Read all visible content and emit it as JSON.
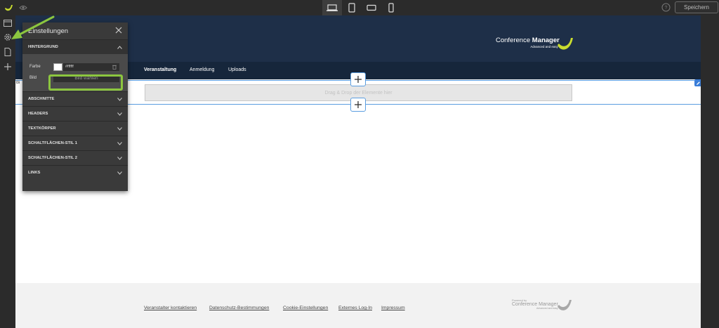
{
  "toolbar": {
    "save_label": "Speichern",
    "devices": [
      "desktop",
      "tablet-portrait",
      "tablet-landscape",
      "phone"
    ]
  },
  "sidebar": {
    "items": [
      "layout-icon",
      "settings-gear-icon",
      "page-icon",
      "add-icon"
    ]
  },
  "site": {
    "brand_name_light": "Conference",
    "brand_name_bold": "Manager",
    "brand_tagline": "Advanced and easy",
    "nav": [
      "Veranstaltung",
      "Anmeldung",
      "Uploads"
    ],
    "selected_tag": "Bi",
    "drop_text": "Drag & Drop der Elemente hier"
  },
  "footer": {
    "links": [
      "Veranstalter kontaktieren",
      "Datenschutz-Bestimmungen",
      "Cookie-Einstellungen",
      "Externes Log-In",
      "Impressum"
    ],
    "powered_by": "Powered by",
    "brand_light": "Conference",
    "brand_bold": "Manager",
    "brand_tagline": "Advanced and easy"
  },
  "panel": {
    "title": "Einstellungen",
    "open_section": "HINTERGRUND",
    "color_label": "Farbe",
    "color_value": "#ffffff",
    "image_label": "Bild",
    "image_button": "Bild wählen",
    "sections": [
      "ABSCHNITTE",
      "HEADERS",
      "TEXTKÖRPER",
      "SCHALTFLÄCHEN-STIL 1",
      "SCHALTFLÄCHEN-STIL 2",
      "LINKS"
    ]
  },
  "colors": {
    "header": "#1e2f48",
    "nav": "#16263b",
    "accent_green": "#8cc63f",
    "selection_blue": "#5a9de0",
    "editor_dark": "#2b2b2b"
  }
}
